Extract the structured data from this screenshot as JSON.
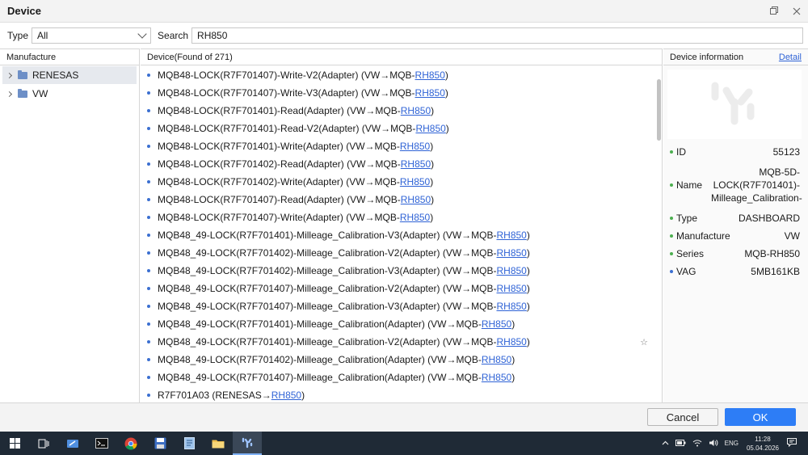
{
  "window": {
    "title": "Device"
  },
  "filter": {
    "type_label": "Type",
    "type_value": "All",
    "search_label": "Search",
    "search_value": "RH850"
  },
  "manufacture": {
    "header": "Manufacture",
    "items": [
      {
        "label": "RENESAS"
      },
      {
        "label": "VW"
      }
    ]
  },
  "devices": {
    "header": "Device(Found of 271)",
    "items": [
      {
        "prefix": "MQB48-LOCK(R7F701407)-Write-V2(Adapter) (VW→MQB-",
        "link": "RH850",
        "suffix": ")"
      },
      {
        "prefix": "MQB48-LOCK(R7F701407)-Write-V3(Adapter) (VW→MQB-",
        "link": "RH850",
        "suffix": ")"
      },
      {
        "prefix": "MQB48-LOCK(R7F701401)-Read(Adapter) (VW→MQB-",
        "link": "RH850",
        "suffix": ")"
      },
      {
        "prefix": "MQB48-LOCK(R7F701401)-Read-V2(Adapter) (VW→MQB-",
        "link": "RH850",
        "suffix": ")"
      },
      {
        "prefix": "MQB48-LOCK(R7F701401)-Write(Adapter) (VW→MQB-",
        "link": "RH850",
        "suffix": ")"
      },
      {
        "prefix": "MQB48-LOCK(R7F701402)-Read(Adapter) (VW→MQB-",
        "link": "RH850",
        "suffix": ")"
      },
      {
        "prefix": "MQB48-LOCK(R7F701402)-Write(Adapter) (VW→MQB-",
        "link": "RH850",
        "suffix": ")"
      },
      {
        "prefix": "MQB48-LOCK(R7F701407)-Read(Adapter) (VW→MQB-",
        "link": "RH850",
        "suffix": ")"
      },
      {
        "prefix": "MQB48-LOCK(R7F701407)-Write(Adapter) (VW→MQB-",
        "link": "RH850",
        "suffix": ")"
      },
      {
        "prefix": "MQB48_49-LOCK(R7F701401)-Milleage_Calibration-V3(Adapter) (VW→MQB-",
        "link": "RH850",
        "suffix": ")"
      },
      {
        "prefix": "MQB48_49-LOCK(R7F701402)-Milleage_Calibration-V2(Adapter) (VW→MQB-",
        "link": "RH850",
        "suffix": ")"
      },
      {
        "prefix": "MQB48_49-LOCK(R7F701402)-Milleage_Calibration-V3(Adapter) (VW→MQB-",
        "link": "RH850",
        "suffix": ")"
      },
      {
        "prefix": "MQB48_49-LOCK(R7F701407)-Milleage_Calibration-V2(Adapter) (VW→MQB-",
        "link": "RH850",
        "suffix": ")"
      },
      {
        "prefix": "MQB48_49-LOCK(R7F701407)-Milleage_Calibration-V3(Adapter) (VW→MQB-",
        "link": "RH850",
        "suffix": ")"
      },
      {
        "prefix": "MQB48_49-LOCK(R7F701401)-Milleage_Calibration(Adapter) (VW→MQB-",
        "link": "RH850",
        "suffix": ")"
      },
      {
        "prefix": "MQB48_49-LOCK(R7F701401)-Milleage_Calibration-V2(Adapter) (VW→MQB-",
        "link": "RH850",
        "suffix": ")",
        "star": "☆"
      },
      {
        "prefix": "MQB48_49-LOCK(R7F701402)-Milleage_Calibration(Adapter) (VW→MQB-",
        "link": "RH850",
        "suffix": ")"
      },
      {
        "prefix": "MQB48_49-LOCK(R7F701407)-Milleage_Calibration(Adapter) (VW→MQB-",
        "link": "RH850",
        "suffix": ")"
      },
      {
        "prefix": "R7F701A03 (RENESAS→",
        "link": "RH850",
        "suffix": ")"
      }
    ]
  },
  "device_info": {
    "header": "Device information",
    "detail_label": "Detail",
    "id_label": "ID",
    "id_value": "55123",
    "name_label": "Name",
    "name_value": "MQB-5D-LOCK(R7F701401)-Milleage_Calibration-",
    "type_label": "Type",
    "type_value": "DASHBOARD",
    "manufacture_label": "Manufacture",
    "manufacture_value": "VW",
    "series_label": "Series",
    "series_value": "MQB-RH850",
    "vag_label": "VAG",
    "vag_value": "5MB161KB"
  },
  "actions": {
    "cancel": "Cancel",
    "ok": "OK"
  },
  "taskbar": {
    "language": "ENG",
    "time": "11:28",
    "date": "05.04.2026"
  },
  "colors": {
    "accent": "#2d7df6",
    "link": "#2f63d6",
    "taskbar": "#1f2a36"
  }
}
